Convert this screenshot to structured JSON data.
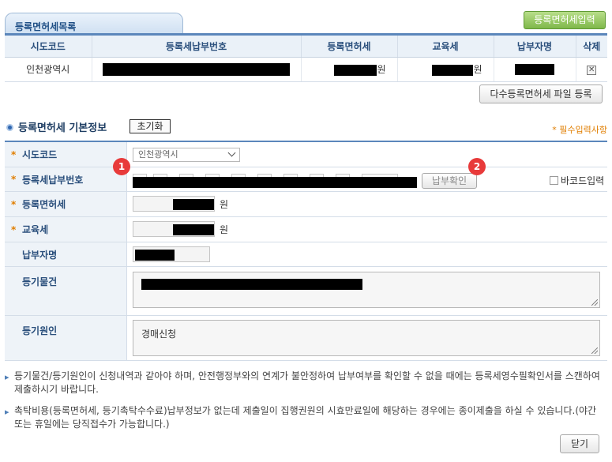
{
  "list": {
    "tab_title": "등록면허세목록",
    "add_button": "등록면허세입력",
    "headers": [
      "시도코드",
      "등록세납부번호",
      "등록면허세",
      "교육세",
      "납부자명",
      "삭제"
    ],
    "rows": [
      {
        "sido": "인천광역시",
        "license_tax_unit": "원",
        "education_tax_unit": "원"
      }
    ],
    "bulk_upload_button": "다수등록면허세 파일 등록"
  },
  "form": {
    "section_title": "등록면허세 기본정보",
    "reset_button": "초기화",
    "required_note": "* 필수입력사항",
    "sido_label": "시도코드",
    "sido_value": "인천광역시",
    "payment_no_label": "등록세납부번호",
    "verify_button": "납부확인",
    "barcode_label": "바코드입력",
    "license_tax_label": "등록면허세",
    "license_tax_unit": "원",
    "education_tax_label": "교육세",
    "education_tax_unit": "원",
    "payer_label": "납부자명",
    "property_label": "등기물건",
    "cause_label": "등기원인",
    "cause_value": "경매신청",
    "badge1": "1",
    "badge2": "2"
  },
  "notes": [
    "등기물건/등기원인이 신청내역과 같아야 하며, 안전행정부와의 연계가 불안정하여 납부여부를 확인할 수 없을 때에는 등록세영수필확인서를 스캔하여 제출하시기 바랍니다.",
    "촉탁비용(등록면허세, 등기촉탁수수료)납부정보가 없는데 제출일이 집행권원의 시효만료일에 해당하는 경우에는 종이제출을 하실 수 있습니다.(야간 또는 휴일에는 당직접수가 가능합니다.)"
  ],
  "close_button": "닫기",
  "colors": {
    "accent_blue": "#5b86bb",
    "required_orange": "#e07e00",
    "badge_red": "#e83a3a",
    "add_green": "#7fb84a"
  }
}
